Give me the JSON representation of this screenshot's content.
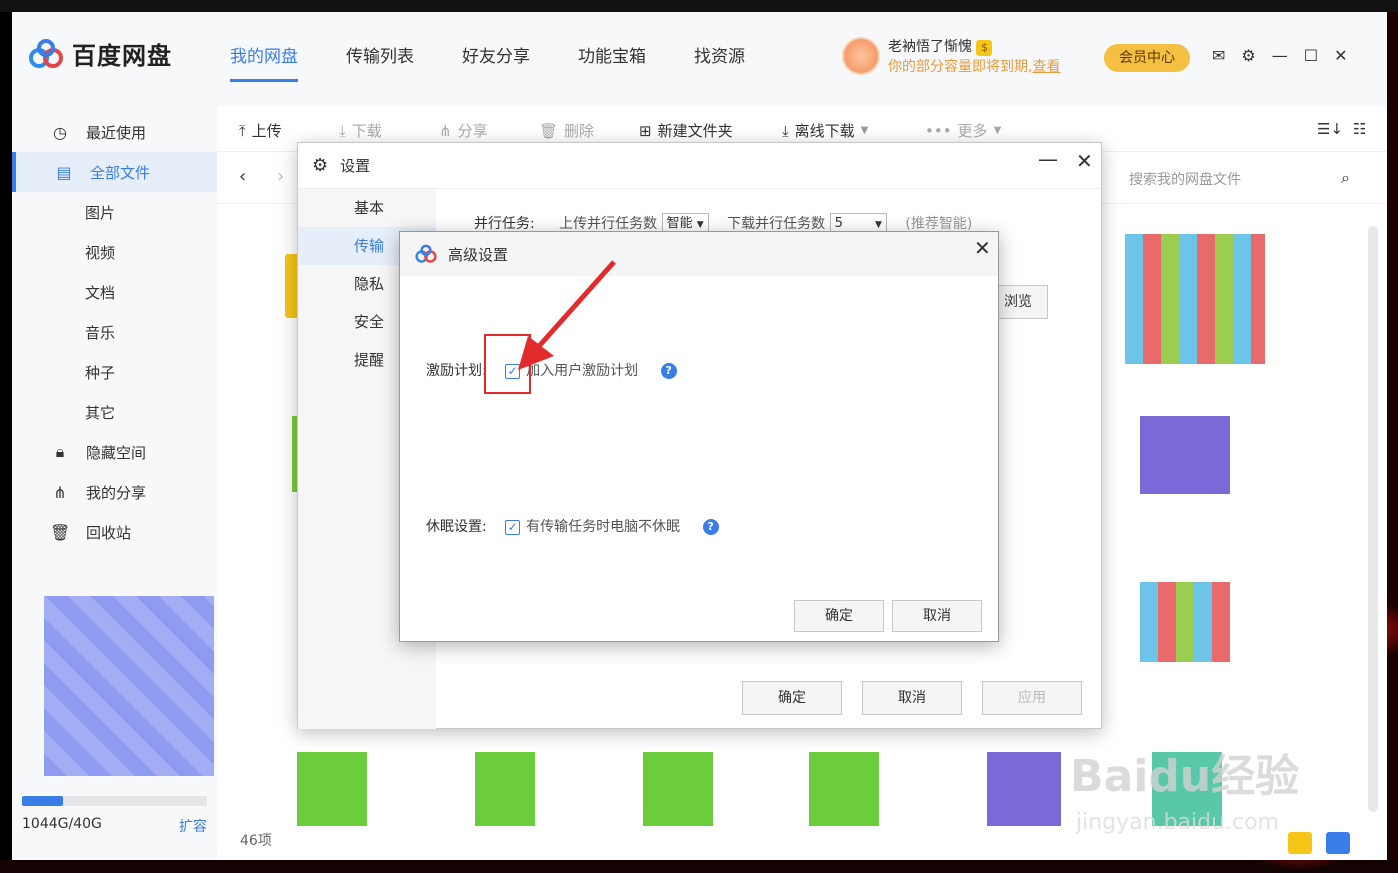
{
  "app": {
    "brand": "百度网盘",
    "nav": [
      "我的网盘",
      "传输列表",
      "好友分享",
      "功能宝箱",
      "找资源"
    ],
    "user_name": "老衲悟了惭愧",
    "user_message": "你的部分容量即将到期,",
    "user_link": "查看",
    "vip_badge": "$",
    "vip_button": "会员中心"
  },
  "sidebar": {
    "items": [
      {
        "label": "最近使用",
        "icon": "clock-icon"
      },
      {
        "label": "全部文件",
        "icon": "document-icon"
      },
      {
        "label": "图片"
      },
      {
        "label": "视频"
      },
      {
        "label": "文档"
      },
      {
        "label": "音乐"
      },
      {
        "label": "种子"
      },
      {
        "label": "其它"
      },
      {
        "label": "隐藏空间",
        "icon": "lock-icon"
      },
      {
        "label": "我的分享",
        "icon": "share-icon"
      },
      {
        "label": "回收站",
        "icon": "trash-icon"
      }
    ],
    "storage_text": "1044G/40G",
    "expand_label": "扩容"
  },
  "toolbar": {
    "upload": "上传",
    "download": "下载",
    "share": "分享",
    "delete": "删除",
    "new_folder": "新建文件夹",
    "offline_download": "离线下载",
    "more": "更多"
  },
  "pathbar": {
    "search_placeholder": "搜索我的网盘文件"
  },
  "footer": {
    "item_count": "46项"
  },
  "settings": {
    "title": "设置",
    "nav": [
      "基本",
      "传输",
      "隐私",
      "安全",
      "提醒"
    ],
    "parallel_label": "并行任务:",
    "upload_parallel_label": "上传并行任务数",
    "upload_parallel_value": "智能",
    "download_parallel_label": "下载并行任务数",
    "download_parallel_value": "5",
    "recommend_text": "(推荐智能)",
    "browse_button": "浏览",
    "ok_button": "确定",
    "cancel_button": "取消",
    "apply_button": "应用"
  },
  "advanced": {
    "title": "高级设置",
    "incentive_label": "激励计划:",
    "incentive_option": "加入用户激励计划",
    "incentive_checked": true,
    "sleep_label": "休眠设置:",
    "sleep_option": "有传输任务时电脑不休眠",
    "sleep_checked": true,
    "help_glyph": "?",
    "ok_button": "确定",
    "cancel_button": "取消"
  },
  "watermark": {
    "brand": "Baidu经验",
    "url": "jingyan.baidu.com"
  },
  "colors": {
    "accent": "#3a7de8",
    "vip": "#f5c041",
    "highlight": "#e32b2b"
  }
}
